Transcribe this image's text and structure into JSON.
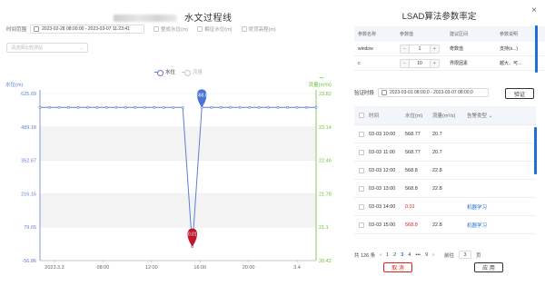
{
  "page": {
    "title": "水文过程线"
  },
  "filters": {
    "time_label": "时间范围",
    "time_range": "2023-02-28 08:00:00 - 2023-03-07 11:23:41",
    "checkboxes": [
      "整成水位(m)",
      "解征水位(m)",
      "堤顶高程(m)"
    ],
    "station_placeholder": "请选择比较测站"
  },
  "legend": {
    "level": "水位",
    "flow": "流量"
  },
  "chart": {
    "left_axis_title": "水位(m)",
    "right_axis_title": "流量(m³/s)",
    "left_ticks": [
      "625.69",
      "489.18",
      "352.67",
      "216.16",
      "79.65",
      "-56.86"
    ],
    "right_ticks": [
      "23.82",
      "23.14",
      "22.46",
      "21.78",
      "21.1",
      "20.42"
    ],
    "x_ticks": [
      "2023.3.3",
      "08:00",
      "12:00",
      "16:00",
      "20:00",
      "3.4"
    ],
    "pin_high": "568.8",
    "pin_low": "0.01",
    "colors": {
      "line": "#5b7fd4",
      "right_axis": "#67c23a",
      "low_pin": "#c0162a",
      "high_pin": "#4a73d6"
    }
  },
  "chart_data": {
    "type": "line",
    "series": [
      {
        "name": "水位",
        "values": [
          568.8,
          568.8,
          568.8,
          568.8,
          568.8,
          568.8,
          568.8,
          568.8,
          568.8,
          568.8,
          568.8,
          568.8,
          568.8,
          568.77,
          568.77,
          568.77,
          0.01,
          568.8,
          568.8,
          568.8,
          568.8,
          568.8,
          568.8,
          568.8,
          568.8,
          568.8,
          568.8,
          568.8,
          568.8,
          568.8
        ]
      }
    ],
    "x_ticks": [
      "2023.3.3",
      "08:00",
      "12:00",
      "16:00",
      "20:00",
      "3.4"
    ],
    "ylabel": "水位(m)",
    "y2label": "流量(m³/s)",
    "ylim": [
      -56.86,
      625.69
    ],
    "y2lim": [
      20.42,
      23.82
    ],
    "grid": true
  },
  "dialog": {
    "title": "LSAD算法参数率定",
    "close": "×",
    "param_headers": [
      "参数名称",
      "参数值",
      "建议区间",
      "参数说明"
    ],
    "params": [
      {
        "name": "window",
        "value": "1",
        "range": "奇数值",
        "desc": "支持(s...)"
      },
      {
        "name": "c",
        "value": "10",
        "range": "界限因素",
        "desc": "越大、可..."
      }
    ],
    "verify_label": "验证时段",
    "verify_range": "2023-03-01 08:00:0 - 2023-03-07 08:00:0",
    "verify_button": "验证",
    "data_headers": [
      "时间",
      "水位(m)",
      "流量(m³/s)",
      "告警类型"
    ],
    "rows": [
      {
        "time": "03-03 10:00",
        "level": "568.77",
        "flow": "20.7",
        "type": ""
      },
      {
        "time": "03-03 11:00",
        "level": "568.77",
        "flow": "20.7",
        "type": ""
      },
      {
        "time": "03-03 12:00",
        "level": "568.8",
        "flow": "22.8",
        "type": ""
      },
      {
        "time": "03-03 13:00",
        "level": "568.8",
        "flow": "22.8",
        "type": ""
      },
      {
        "time": "03-03 14:00",
        "level": "0.01",
        "flow": "",
        "type": "机器学习"
      },
      {
        "time": "03-03 15:00",
        "level": "568.8",
        "flow": "22.8",
        "type": "机器学习"
      }
    ],
    "pager": {
      "total": "共 126 条",
      "pages": [
        "1",
        "2",
        "3",
        "4",
        "•••",
        "9"
      ],
      "goto": "前往",
      "page_value": "3",
      "page_unit": "页"
    },
    "cancel": "取 消",
    "apply": "应 用"
  }
}
